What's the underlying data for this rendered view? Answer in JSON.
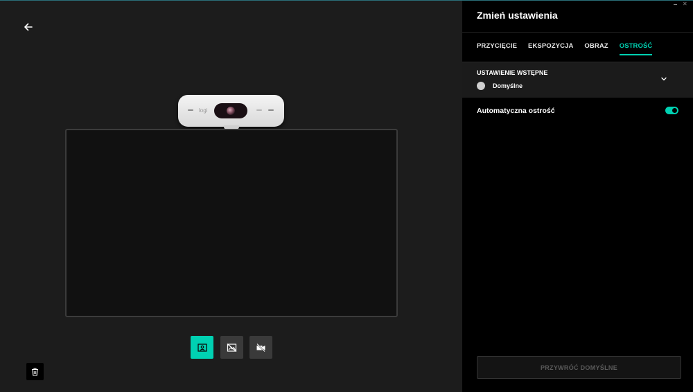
{
  "left": {
    "back_icon": "arrow-left-icon",
    "webcam": {
      "logo_text": "logi"
    },
    "controls": [
      {
        "icon": "person-frame-icon",
        "active": true
      },
      {
        "icon": "background-off-icon",
        "active": false
      },
      {
        "icon": "camera-off-icon",
        "active": false
      }
    ],
    "trash_icon": "trash-icon"
  },
  "panel": {
    "title": "Zmień ustawienia",
    "tabs": [
      {
        "label": "PRZYCIĘCIE",
        "active": false
      },
      {
        "label": "EKSPOZYCJA",
        "active": false
      },
      {
        "label": "OBRAZ",
        "active": false
      },
      {
        "label": "OSTROŚĆ",
        "active": true
      }
    ],
    "preset": {
      "label": "USTAWIENIE WSTĘPNE",
      "value": "Domyślne"
    },
    "autofocus": {
      "label": "Automatyczna ostrość",
      "enabled": true
    },
    "reset_label": "PRZYWRÓĆ DOMYŚLNE"
  },
  "colors": {
    "accent": "#00d1b2",
    "left_bg": "#1c1c1c",
    "right_bg": "#000000"
  }
}
